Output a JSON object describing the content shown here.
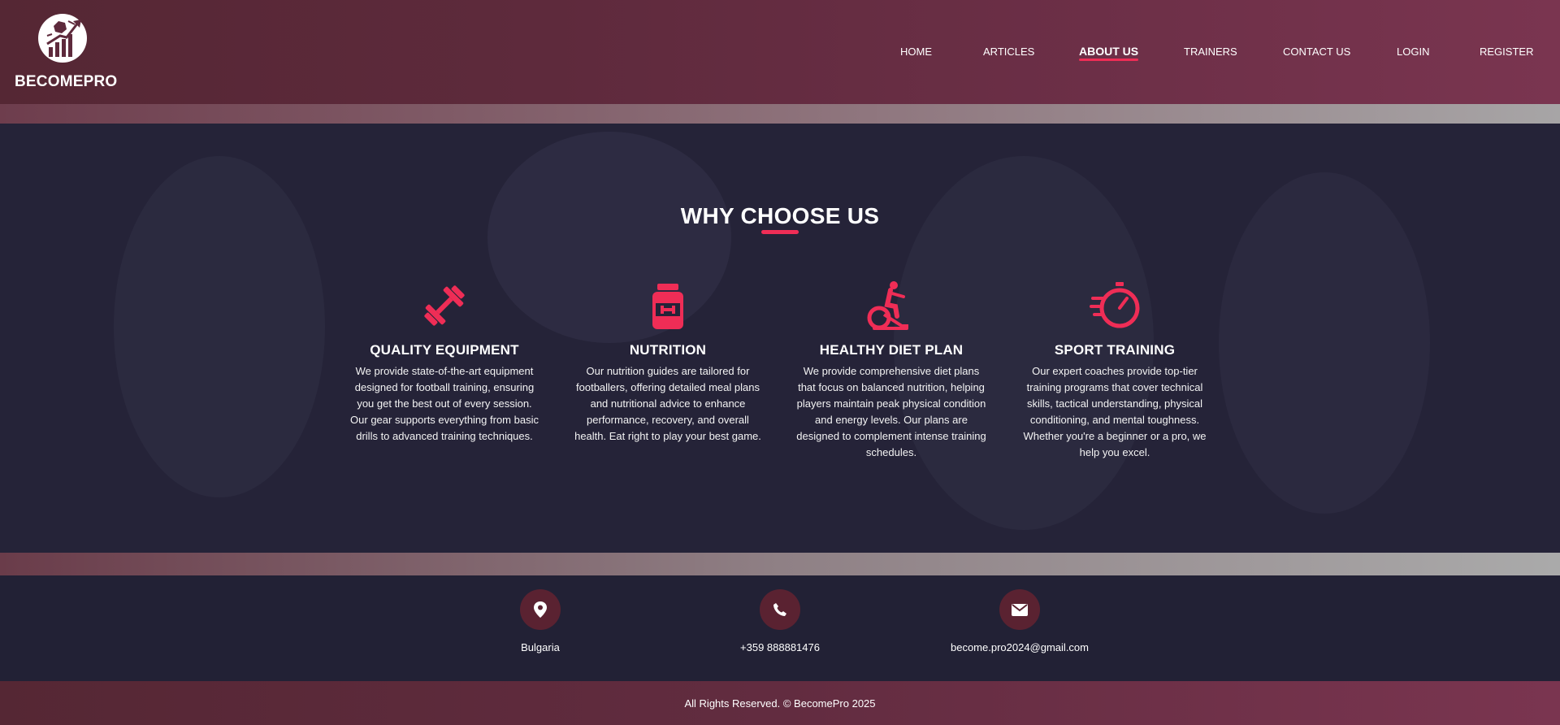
{
  "brand": {
    "name": "BECOMEPRO"
  },
  "nav": {
    "items": [
      {
        "label": "HOME",
        "active": false
      },
      {
        "label": "ARTICLES",
        "active": false
      },
      {
        "label": "ABOUT US",
        "active": true
      },
      {
        "label": "TRAINERS",
        "active": false
      },
      {
        "label": "CONTACT US",
        "active": false
      },
      {
        "label": "LOGIN",
        "active": false
      },
      {
        "label": "REGISTER",
        "active": false
      }
    ]
  },
  "section": {
    "title": "WHY CHOOSE US"
  },
  "features": [
    {
      "icon": "dumbbell-icon",
      "title": "QUALITY EQUIPMENT",
      "text": "We provide state-of-the-art equipment designed for football training, ensuring you get the best out of every session. Our gear supports everything from basic drills to advanced training techniques."
    },
    {
      "icon": "supplement-jar-icon",
      "title": "NUTRITION",
      "text": "Our nutrition guides are tailored for footballers, offering detailed meal plans and nutritional advice to enhance performance, recovery, and overall health. Eat right to play your best game."
    },
    {
      "icon": "exercise-bike-icon",
      "title": "HEALTHY DIET PLAN",
      "text": "We provide comprehensive diet plans that focus on balanced nutrition, helping players maintain peak physical condition and energy levels. Our plans are designed to complement intense training schedules."
    },
    {
      "icon": "stopwatch-icon",
      "title": "SPORT TRAINING",
      "text": "Our expert coaches provide top-tier training programs that cover technical skills, tactical understanding, physical conditioning, and mental toughness. Whether you're a beginner or a pro, we help you excel."
    }
  ],
  "contact": [
    {
      "icon": "location-pin-icon",
      "text": "Bulgaria"
    },
    {
      "icon": "phone-icon",
      "text": "+359 888881476"
    },
    {
      "icon": "envelope-icon",
      "text": "become.pro2024@gmail.com"
    }
  ],
  "footer": {
    "text": "All Rights Reserved. © BecomePro 2025"
  },
  "colors": {
    "accent": "#ef2d56",
    "header": "#6c2f47",
    "background": "#232234",
    "icon_circle": "#5a2231"
  }
}
